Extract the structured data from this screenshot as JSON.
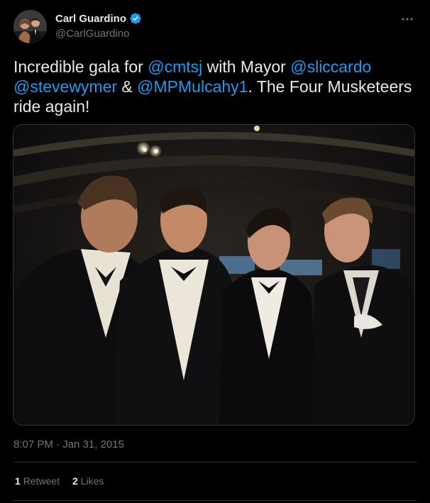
{
  "author": {
    "name": "Carl Guardino",
    "handle": "@CarlGuardino",
    "verified": true
  },
  "menu_icon": "more-horizontal-icon",
  "tweet": {
    "parts": [
      {
        "t": "Incredible gala for ",
        "m": false
      },
      {
        "t": "@cmtsj",
        "m": true
      },
      {
        "t": " with Mayor ",
        "m": false
      },
      {
        "t": "@sliccardo",
        "m": true
      },
      {
        "t": " ",
        "m": false
      },
      {
        "t": "@stevewymer",
        "m": true
      },
      {
        "t": " & ",
        "m": false
      },
      {
        "t": "@MPMulcahy1",
        "m": true
      },
      {
        "t": ". The Four Musketeers ride again!",
        "m": false
      }
    ]
  },
  "timestamp": "8:07 PM · Jan 31, 2015",
  "stats": {
    "retweets": "1",
    "retweets_label": "Retweet",
    "likes": "2",
    "likes_label": "Likes"
  },
  "colors": {
    "background": "#000000",
    "text": "#e7e9ea",
    "muted": "#71767b",
    "link": "#1d9bf0",
    "verified": "#1d9bf0"
  }
}
